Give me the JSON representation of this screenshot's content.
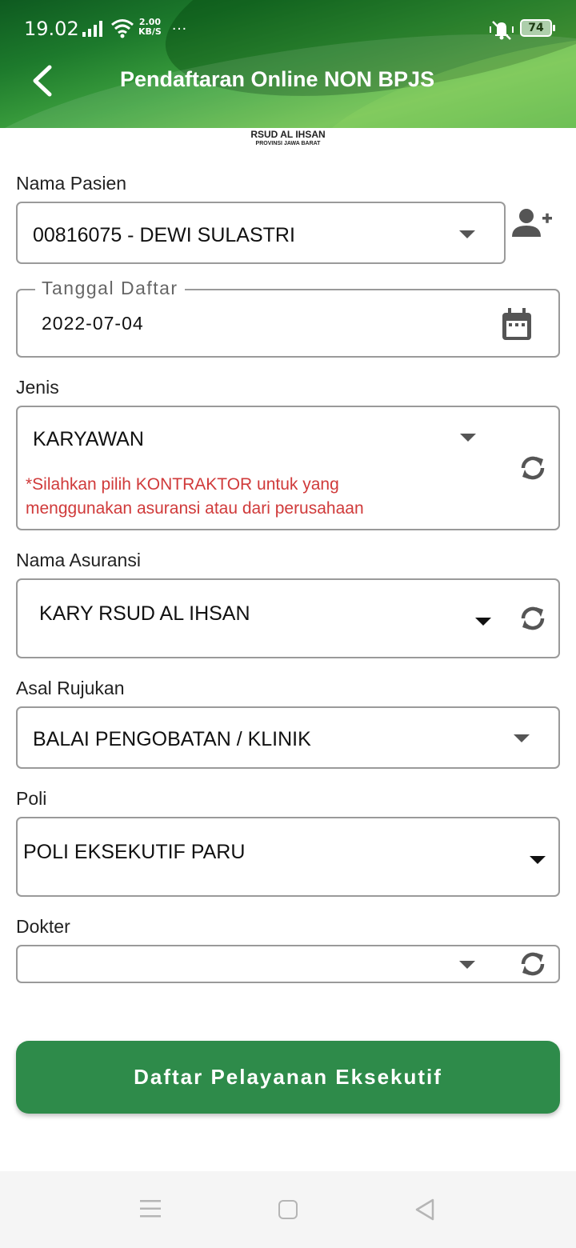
{
  "status_bar": {
    "time": "19.02",
    "speed_value": "2.00",
    "speed_unit": "KB/S",
    "more": "…",
    "battery": "74"
  },
  "header": {
    "title": "Pendaftaran Online NON BPJS",
    "back_icon": "chevron-left-icon"
  },
  "logo": {
    "name": "RSUD AL IHSAN",
    "subtitle": "PROVINSI JAWA BARAT"
  },
  "form": {
    "nama_pasien": {
      "label": "Nama Pasien",
      "value": "00816075 - DEWI SULASTRI",
      "add_icon": "add-person-icon"
    },
    "tanggal_daftar": {
      "label": "Tanggal Daftar",
      "value": "2022-07-04",
      "icon": "calendar-icon"
    },
    "jenis": {
      "label": "Jenis",
      "value": "KARYAWAN",
      "hint_line1": "*Silahkan pilih KONTRAKTOR untuk yang",
      "hint_line2": "menggunakan asuransi atau dari perusahaan"
    },
    "nama_asuransi": {
      "label": "Nama Asuransi",
      "value": "KARY RSUD AL IHSAN"
    },
    "asal_rujukan": {
      "label": "Asal Rujukan",
      "value": "BALAI PENGOBATAN / KLINIK"
    },
    "poli": {
      "label": "Poli",
      "value": "POLI EKSEKUTIF PARU"
    },
    "dokter": {
      "label": "Dokter",
      "value": ""
    }
  },
  "submit_label": "Daftar Pelayanan Eksekutif",
  "colors": {
    "primary_button": "#2e8b4a",
    "hint_text": "#d03a3a",
    "header_green": "#3ea23f"
  }
}
